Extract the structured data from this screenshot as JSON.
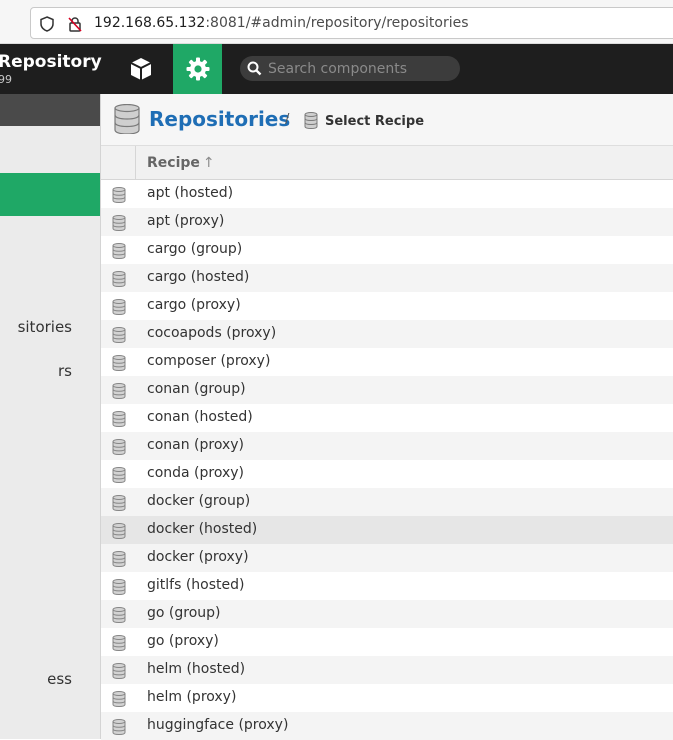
{
  "browser": {
    "url_host": "192.168.65.132",
    "url_rest": ":8081/#admin/repository/repositories"
  },
  "header": {
    "brand_title": "Repository",
    "brand_version": "99",
    "search_placeholder": "Search components"
  },
  "sidebar": {
    "items": [
      {
        "label": "sitories"
      },
      {
        "label": "rs"
      },
      {
        "label": "ess"
      }
    ]
  },
  "breadcrumb": {
    "title": "Repositories",
    "separator": "/",
    "current": "Select Recipe"
  },
  "grid": {
    "column_header": "Recipe",
    "sort_glyph": "↑",
    "rows": [
      {
        "label": "apt (hosted)"
      },
      {
        "label": "apt (proxy)"
      },
      {
        "label": "cargo (group)"
      },
      {
        "label": "cargo (hosted)"
      },
      {
        "label": "cargo (proxy)"
      },
      {
        "label": "cocoapods (proxy)"
      },
      {
        "label": "composer (proxy)"
      },
      {
        "label": "conan (group)"
      },
      {
        "label": "conan (hosted)"
      },
      {
        "label": "conan (proxy)"
      },
      {
        "label": "conda (proxy)"
      },
      {
        "label": "docker (group)"
      },
      {
        "label": "docker (hosted)"
      },
      {
        "label": "docker (proxy)"
      },
      {
        "label": "gitlfs (hosted)"
      },
      {
        "label": "go (group)"
      },
      {
        "label": "go (proxy)"
      },
      {
        "label": "helm (hosted)"
      },
      {
        "label": "helm (proxy)"
      },
      {
        "label": "huggingface (proxy)"
      }
    ]
  },
  "colors": {
    "accent_green": "#1fa866",
    "header_bg": "#1e1e1e",
    "link_blue": "#1f6eb5"
  }
}
